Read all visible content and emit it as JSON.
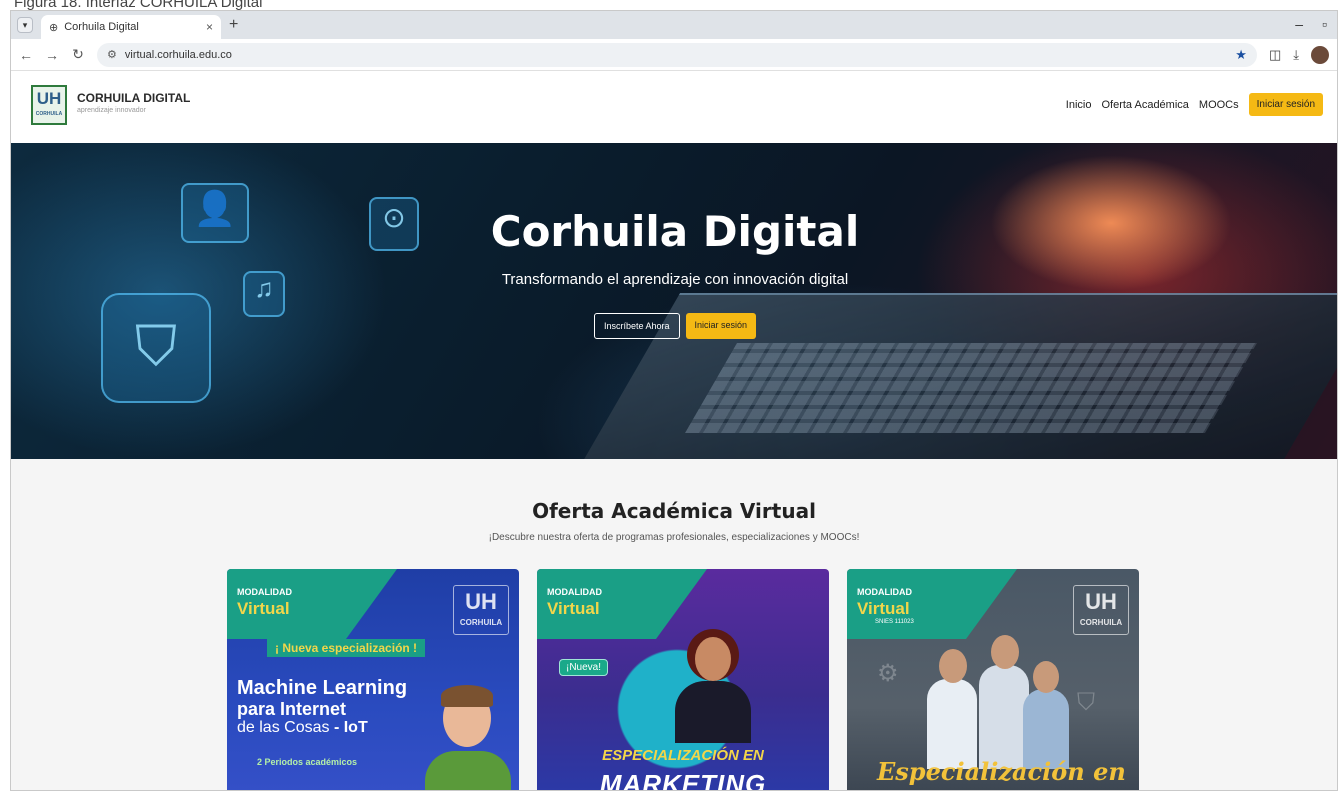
{
  "caption": "Figura 18. Interfaz CORHUILA Digital",
  "browser": {
    "tab_title": "Corhuila Digital",
    "url": "virtual.corhuila.edu.co"
  },
  "site": {
    "brand_name": "CORHUILA DIGITAL",
    "brand_tagline": "aprendizaje innovador",
    "logo_mark": "UH",
    "logo_sub": "CORHUILA",
    "nav": [
      "Inicio",
      "Oferta Académica",
      "MOOCs"
    ],
    "login_label": "Iniciar sesión"
  },
  "hero": {
    "title": "Corhuila Digital",
    "subtitle": "Transformando el aprendizaje con innovación digital",
    "btn_register": "Inscríbete Ahora",
    "btn_login": "Iniciar sesión"
  },
  "offer": {
    "title": "Oferta Académica Virtual",
    "subtitle": "¡Descubre nuestra oferta de programas profesionales, especializaciones y MOOCs!"
  },
  "cards": [
    {
      "mod_line1": "MODALIDAD",
      "mod_line2": "Virtual",
      "logo_mark": "UH",
      "logo_sub": "CORHUILA",
      "badge": "¡ Nueva especialización !",
      "title1": "Machine Learning",
      "title2": "para Internet",
      "title3a": "de las Cosas",
      "title3b": "- IoT",
      "periods": "2 Periodos académicos"
    },
    {
      "mod_line1": "MODALIDAD",
      "mod_line2": "Virtual",
      "badge": "¡Nueva!",
      "line1": "ESPECIALIZACIÓN EN",
      "line2": "MARKETING"
    },
    {
      "mod_line1": "MODALIDAD",
      "mod_line2": "Virtual",
      "snies": "SNIES 111023",
      "logo_mark": "UH",
      "logo_sub": "CORHUILA",
      "line1": "Especialización en"
    }
  ],
  "colors": {
    "accent_yellow": "#f5b914",
    "teal": "#1a9f86",
    "hero_dark": "#0b1624"
  }
}
